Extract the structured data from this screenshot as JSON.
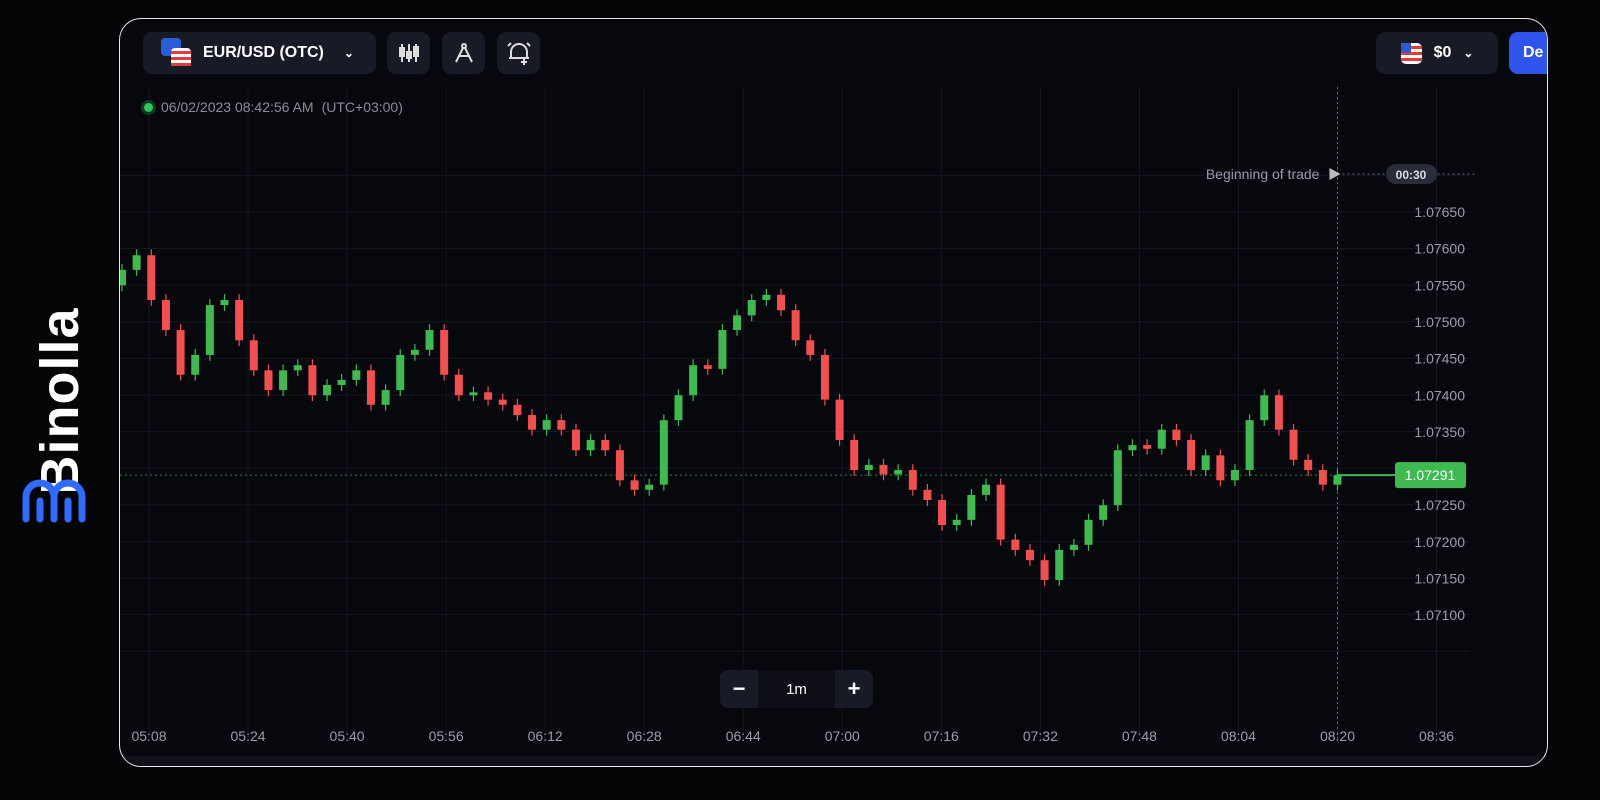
{
  "brand": {
    "name": "Binolla",
    "color": "#2f6bff"
  },
  "toolbar": {
    "pair": "EUR/USD (OTC)",
    "icons": [
      "candlestick-chart-icon",
      "drawing-compass-icon",
      "alert-bell-add-icon"
    ],
    "balance": "$0",
    "deposit": "De"
  },
  "status": {
    "datetime": "06/02/2023 08:42:56 AM",
    "timezone": "(UTC+03:00)"
  },
  "trade": {
    "label": "Beginning of trade",
    "timer": "00:30"
  },
  "zoom": {
    "minus": "−",
    "interval": "1m",
    "plus": "+"
  },
  "chart_data": {
    "type": "candlestick",
    "x_ticks": [
      "05:08",
      "05:24",
      "05:40",
      "05:56",
      "06:12",
      "06:28",
      "06:44",
      "07:00",
      "07:16",
      "07:32",
      "07:48",
      "08:04",
      "08:20",
      "08:36"
    ],
    "y_ticks": [
      "1.07650",
      "1.07600",
      "1.07550",
      "1.07500",
      "1.07450",
      "1.07400",
      "1.07350",
      "1.07300",
      "1.07250",
      "1.07200",
      "1.07150",
      "1.07100"
    ],
    "ylim": [
      1.071,
      1.0765
    ],
    "x_range": [
      "05:04",
      "08:20"
    ],
    "current_price": "1.07291",
    "colors": {
      "up": "#3fb950",
      "down": "#f0504f",
      "current": "#3fb950"
    },
    "first_open": 1.0755,
    "closes": [
      1.07571,
      1.07591,
      1.0753,
      1.07489,
      1.07428,
      1.07455,
      1.07523,
      1.0753,
      1.07475,
      1.07434,
      1.07407,
      1.07434,
      1.07441,
      1.074,
      1.07414,
      1.07421,
      1.07434,
      1.07387,
      1.07407,
      1.07455,
      1.07462,
      1.07489,
      1.07428,
      1.074,
      1.07404,
      1.07394,
      1.07387,
      1.07373,
      1.07353,
      1.07366,
      1.07353,
      1.07325,
      1.07339,
      1.07325,
      1.07284,
      1.07271,
      1.07278,
      1.07366,
      1.074,
      1.07441,
      1.07436,
      1.07489,
      1.07509,
      1.0753,
      1.07537,
      1.07516,
      1.07475,
      1.07455,
      1.07394,
      1.07339,
      1.07298,
      1.07305,
      1.07292,
      1.07298,
      1.07271,
      1.07257,
      1.07223,
      1.0723,
      1.07264,
      1.07278,
      1.07203,
      1.07189,
      1.07175,
      1.07148,
      1.07189,
      1.07196,
      1.0723,
      1.0725,
      1.07325,
      1.07332,
      1.07327,
      1.07353,
      1.07339,
      1.07298,
      1.07318,
      1.07284,
      1.07298,
      1.07366,
      1.074,
      1.07353,
      1.07312,
      1.07298,
      1.07278,
      1.07291
    ]
  }
}
